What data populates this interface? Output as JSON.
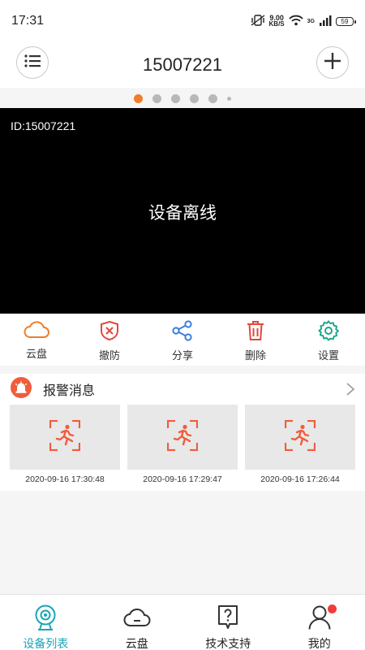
{
  "status_bar": {
    "time": "17:31",
    "net_speed_value": "9.00",
    "net_speed_unit": "KB/S",
    "network_type": "3G",
    "battery": "59"
  },
  "header": {
    "title": "15007221",
    "menu_icon": "list-icon",
    "add_icon": "plus-icon"
  },
  "pager": {
    "count": 6,
    "active_index": 0
  },
  "video": {
    "device_id": "ID:15007221",
    "status": "设备离线"
  },
  "actions": [
    {
      "label": "云盘",
      "icon": "cloud-icon",
      "color": "#f07d2c"
    },
    {
      "label": "撤防",
      "icon": "shield-x-icon",
      "color": "#e2483b"
    },
    {
      "label": "分享",
      "icon": "share-icon",
      "color": "#3d7ee0"
    },
    {
      "label": "删除",
      "icon": "trash-icon",
      "color": "#e2483b"
    },
    {
      "label": "设置",
      "icon": "gear-icon",
      "color": "#1aa58a"
    }
  ],
  "alarm": {
    "title": "报警消息",
    "items": [
      {
        "timestamp": "2020-09-16 17:30:48"
      },
      {
        "timestamp": "2020-09-16 17:29:47"
      },
      {
        "timestamp": "2020-09-16 17:26:44"
      }
    ]
  },
  "bottom_nav": [
    {
      "label": "设备列表",
      "icon": "camera-icon",
      "active": true
    },
    {
      "label": "云盘",
      "icon": "cloud-icon",
      "active": false
    },
    {
      "label": "技术支持",
      "icon": "help-icon",
      "active": false
    },
    {
      "label": "我的",
      "icon": "user-icon",
      "active": false,
      "badge": true
    }
  ],
  "colors": {
    "accent": "#19a5b8",
    "pager_active": "#f07d2c",
    "alarm_icon": "#f05c3c"
  }
}
